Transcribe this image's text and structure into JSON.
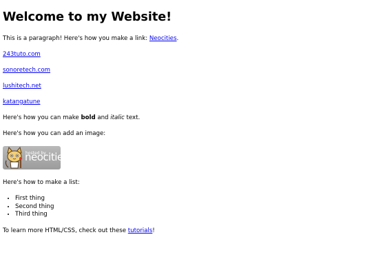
{
  "heading": "Welcome to my Website!",
  "intro": {
    "text": "This is a paragraph! Here's how you make a link: ",
    "link": "Neocities",
    "after": "."
  },
  "links": [
    "243tuto.com",
    "sonoretech.com",
    "lushitech.net",
    "katangatune"
  ],
  "formatting": {
    "before": "Here's how you can make ",
    "bold": "bold",
    "middle": " and ",
    "italic": "italic",
    "after": " text."
  },
  "image_intro": "Here's how you can add an image:",
  "badge": {
    "small": "hosted by",
    "brand": "neocities",
    "icon": "neocities-cat-icon"
  },
  "list_intro": "Here's how to make a list:",
  "list_items": [
    "First thing",
    "Second thing",
    "Third thing"
  ],
  "outro": {
    "text": "To learn more HTML/CSS, check out these ",
    "link": "tutorials",
    "after": "!"
  }
}
